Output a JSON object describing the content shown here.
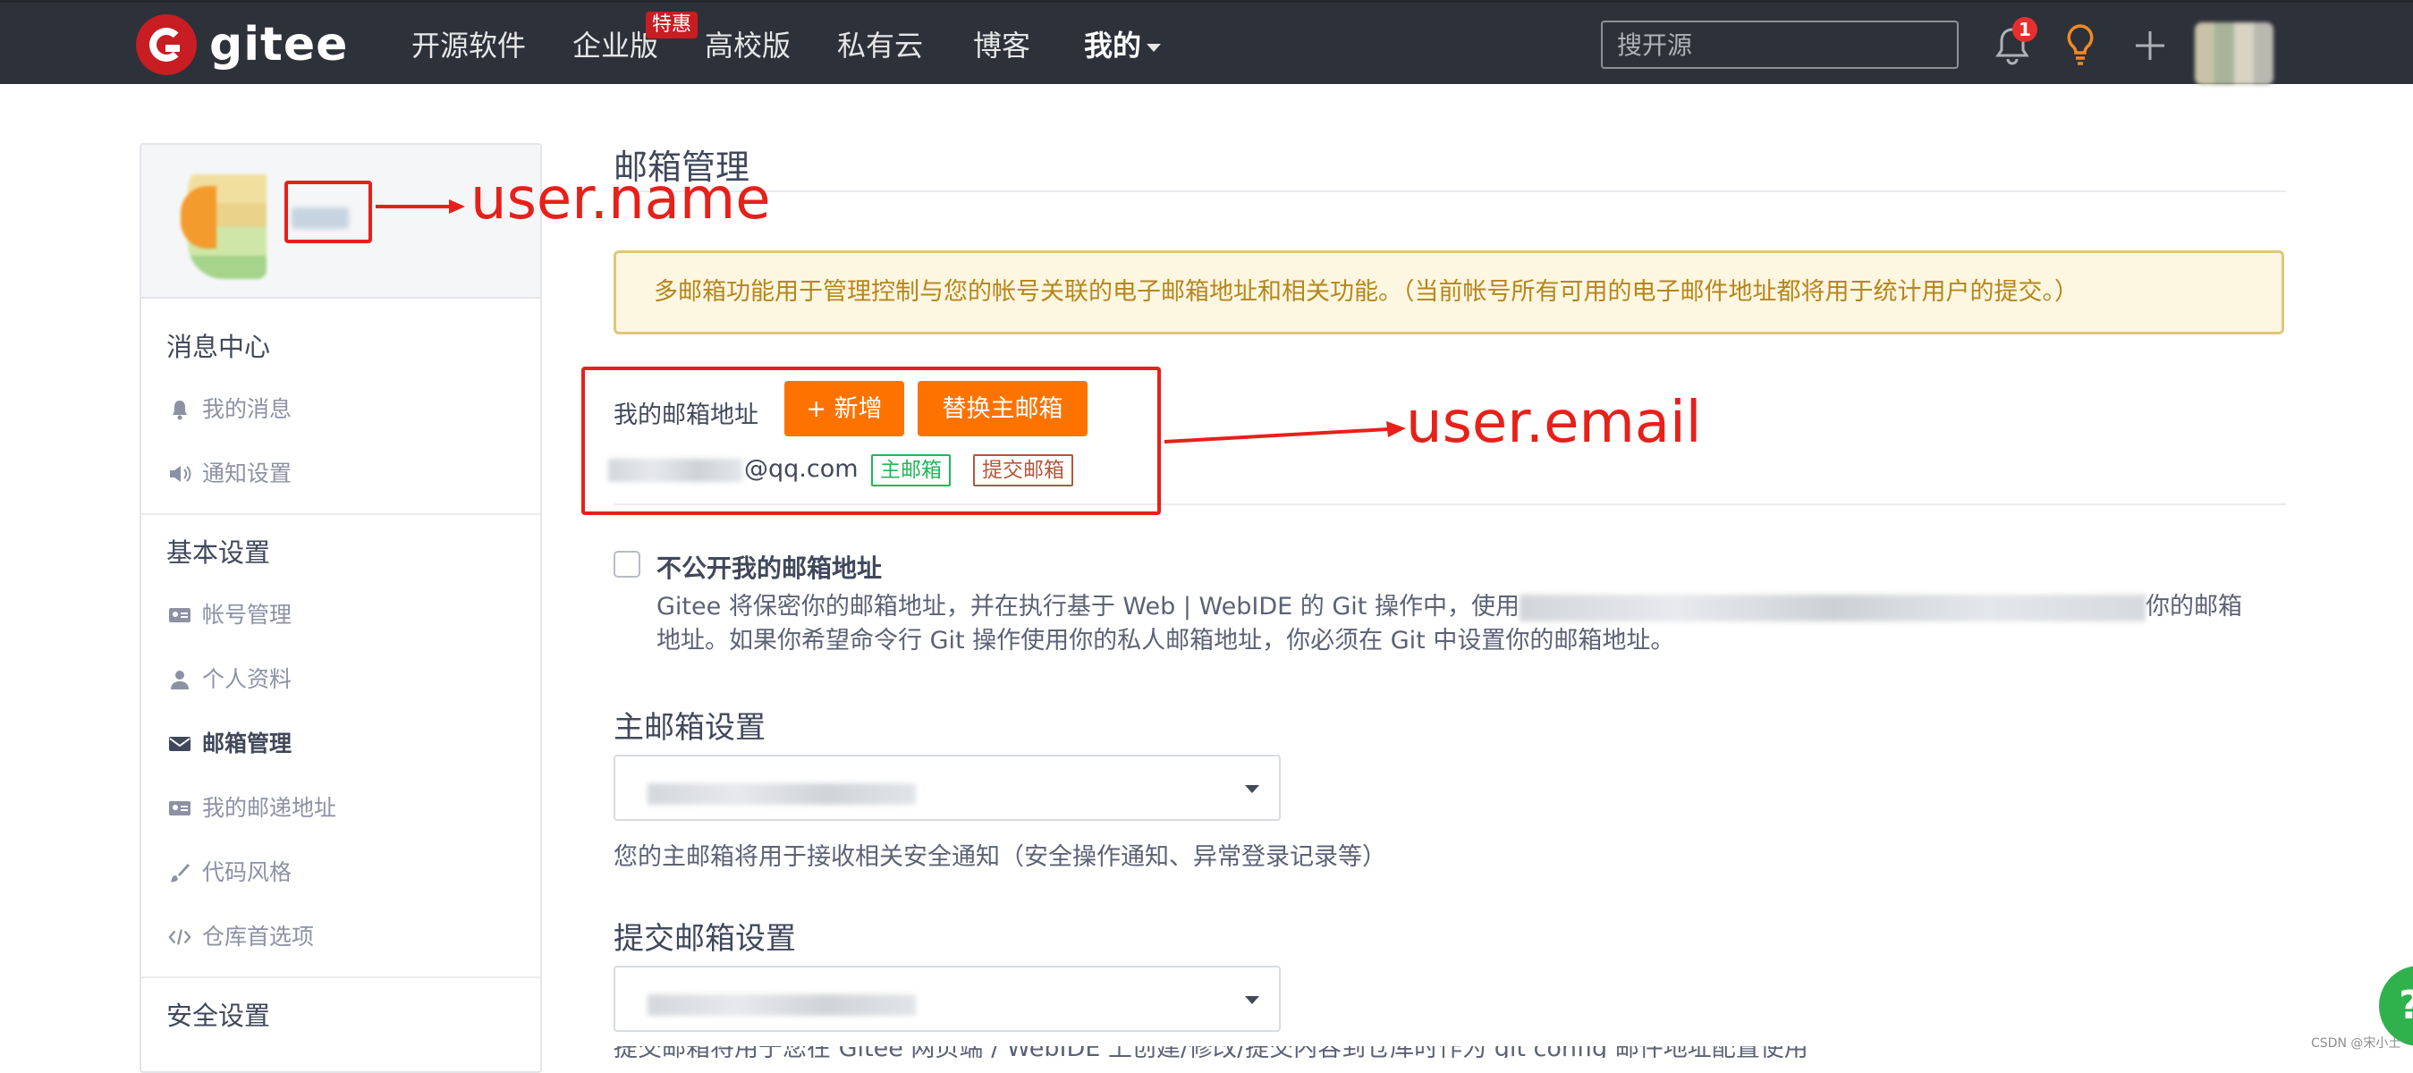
{
  "nav": {
    "logo_text": "gitee",
    "items": [
      "开源软件",
      "企业版",
      "高校版",
      "私有云",
      "博客",
      "我的"
    ],
    "enterprise_badge": "特惠",
    "search_placeholder": "搜开源",
    "notification_count": "1"
  },
  "sidebar": {
    "groups": [
      {
        "title": "消息中心",
        "items": [
          {
            "label": "我的消息",
            "icon": "bell-icon"
          },
          {
            "label": "通知设置",
            "icon": "speaker-icon"
          }
        ]
      },
      {
        "title": "基本设置",
        "items": [
          {
            "label": "帐号管理",
            "icon": "id-card-icon"
          },
          {
            "label": "个人资料",
            "icon": "person-icon"
          },
          {
            "label": "邮箱管理",
            "icon": "envelope-icon",
            "active": true
          },
          {
            "label": "我的邮递地址",
            "icon": "id-card-icon"
          },
          {
            "label": "代码风格",
            "icon": "brush-icon"
          },
          {
            "label": "仓库首选项",
            "icon": "code-icon"
          }
        ]
      },
      {
        "title": "安全设置"
      }
    ]
  },
  "main": {
    "page_title": "邮箱管理",
    "notice": "多邮箱功能用于管理控制与您的帐号关联的电子邮箱地址和相关功能。（当前帐号所有可用的电子邮件地址都将用于统计用户的提交。）",
    "email_label": "我的邮箱地址",
    "add_button": "+ 新增",
    "replace_button": "替换主邮箱",
    "email_domain": "@qq.com",
    "tag_primary": "主邮箱",
    "tag_commit": "提交邮箱",
    "privacy_title": "不公开我的邮箱地址",
    "privacy_desc_start": "Gitee 将保密你的邮箱地址，并在执行基于 Web | WebIDE 的 Git 操作中，使用",
    "privacy_desc_end": "你的邮箱地址。如果你希望命令行 Git 操作使用你的私人邮箱地址，你必须在 Git 中设置你的邮箱地址。",
    "primary_section_title": "主邮箱设置",
    "primary_hint": "您的主邮箱将用于接收相关安全通知（安全操作通知、异常登录记录等）",
    "commit_section_title": "提交邮箱设置",
    "commit_hint": "提交邮箱将用于您在 Gitee 网页端 / WebIDE 上创建/修改/提交内容到仓库时作为 git config 邮件地址配置使用"
  },
  "annotations": {
    "name_label": "user.name",
    "email_label": "user.email",
    "color": "#e7201a"
  },
  "watermark": "CSDN @宋小土",
  "colors": {
    "nav_bg": "#2d313a",
    "accent_orange": "#fe7300",
    "brand_red": "#c71d23",
    "tag_green": "#20b75a"
  }
}
